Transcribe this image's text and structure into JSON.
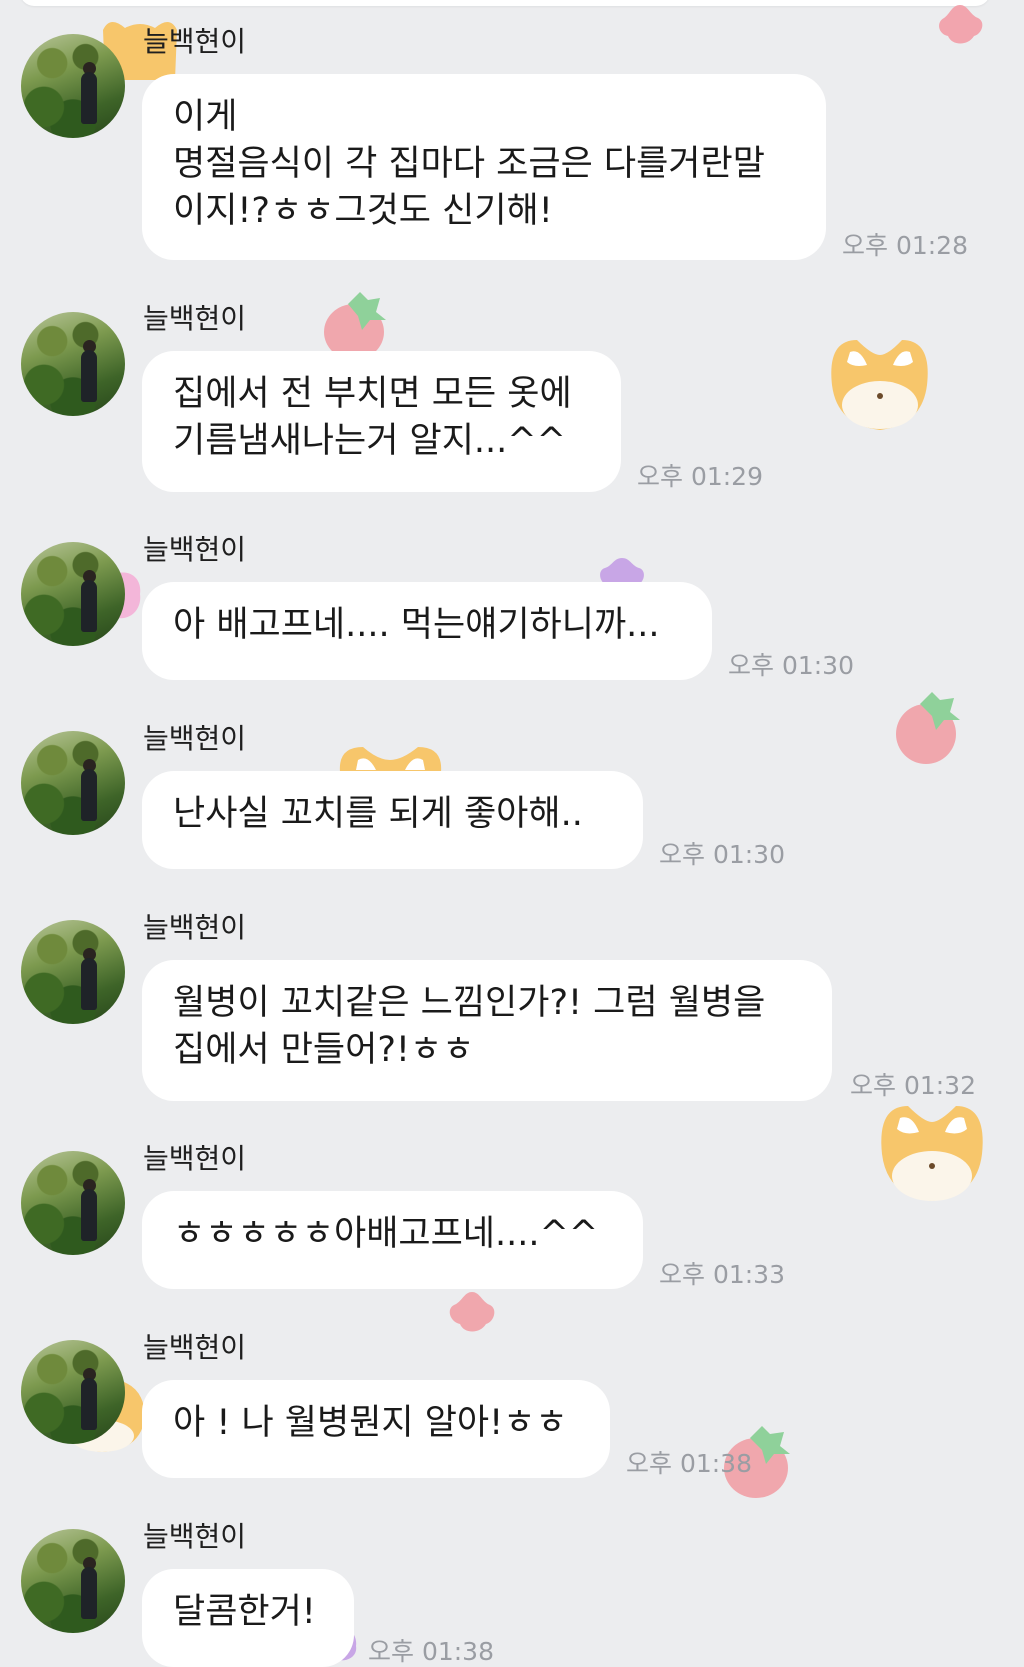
{
  "messages": [
    {
      "sender": "늘백현이",
      "text": "이게\n명절음식이 각 집마다 조금은 다를거란말\n이지!?ㅎㅎ그것도 신기해!",
      "time": "오후 01:28"
    },
    {
      "sender": "늘백현이",
      "text": "집에서 전 부치면 모든 옷에\n기름냄새나는거 알지...^^",
      "time": "오후 01:29"
    },
    {
      "sender": "늘백현이",
      "text": "아 배고프네.... 먹는얘기하니까...",
      "time": "오후 01:30"
    },
    {
      "sender": "늘백현이",
      "text": "난사실 꼬치를 되게 좋아해..",
      "time": "오후 01:30"
    },
    {
      "sender": "늘백현이",
      "text": "월병이 꼬치같은 느낌인가?! 그럼 월병을\n집에서 만들어?!ㅎㅎ",
      "time": "오후 01:32"
    },
    {
      "sender": "늘백현이",
      "text": "ㅎㅎㅎㅎㅎ아배고프네....^^",
      "time": "오후 01:33"
    },
    {
      "sender": "늘백현이",
      "text": "아 ! 나 월병뭔지 알아!ㅎㅎ",
      "time": "오후 01:38"
    },
    {
      "sender": "늘백현이",
      "text": "달콤한거!",
      "time": "오후 01:38"
    }
  ],
  "icons": [
    "profile-photo-avatar",
    "strawberry-sticker",
    "fox-face-sticker",
    "flower-sticker"
  ]
}
